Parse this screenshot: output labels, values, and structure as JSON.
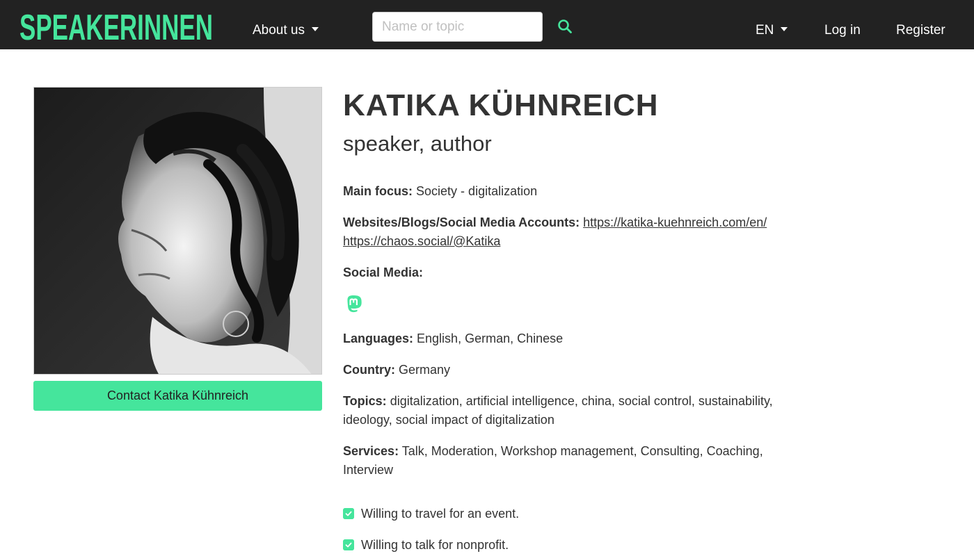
{
  "navbar": {
    "logo_text": "SPEAKERINNEN",
    "about_label": "About us",
    "search": {
      "placeholder": "Name or topic",
      "value": ""
    },
    "language": "EN",
    "login_label": "Log in",
    "register_label": "Register"
  },
  "profile": {
    "contact_button": "Contact Katika Kühnreich",
    "name": "KATIKA KÜHNREICH",
    "subtitle": "speaker, author",
    "main_focus": {
      "label": "Main focus:",
      "value": "Society - digitalization"
    },
    "websites": {
      "label": "Websites/Blogs/Social Media Accounts:",
      "links": [
        "https://katika-kuehnreich.com/en/",
        "https://chaos.social/@Katika"
      ]
    },
    "social_media": {
      "label": "Social Media:",
      "icon": "mastodon-icon"
    },
    "languages": {
      "label": "Languages:",
      "value": "English, German, Chinese"
    },
    "country": {
      "label": "Country:",
      "value": "Germany"
    },
    "topics": {
      "label": "Topics:",
      "value": "digitalization, artificial intelligence, china, social control, sustainability, ideology, social impact of digitalization"
    },
    "services": {
      "label": "Services:",
      "value": "Talk, Moderation, Workshop management, Consulting, Coaching, Interview"
    },
    "checks": [
      "Willing to travel for an event.",
      "Willing to talk for nonprofit."
    ]
  },
  "colors": {
    "accent": "#45e59c",
    "navbar_bg": "#222222",
    "text": "#333333"
  }
}
